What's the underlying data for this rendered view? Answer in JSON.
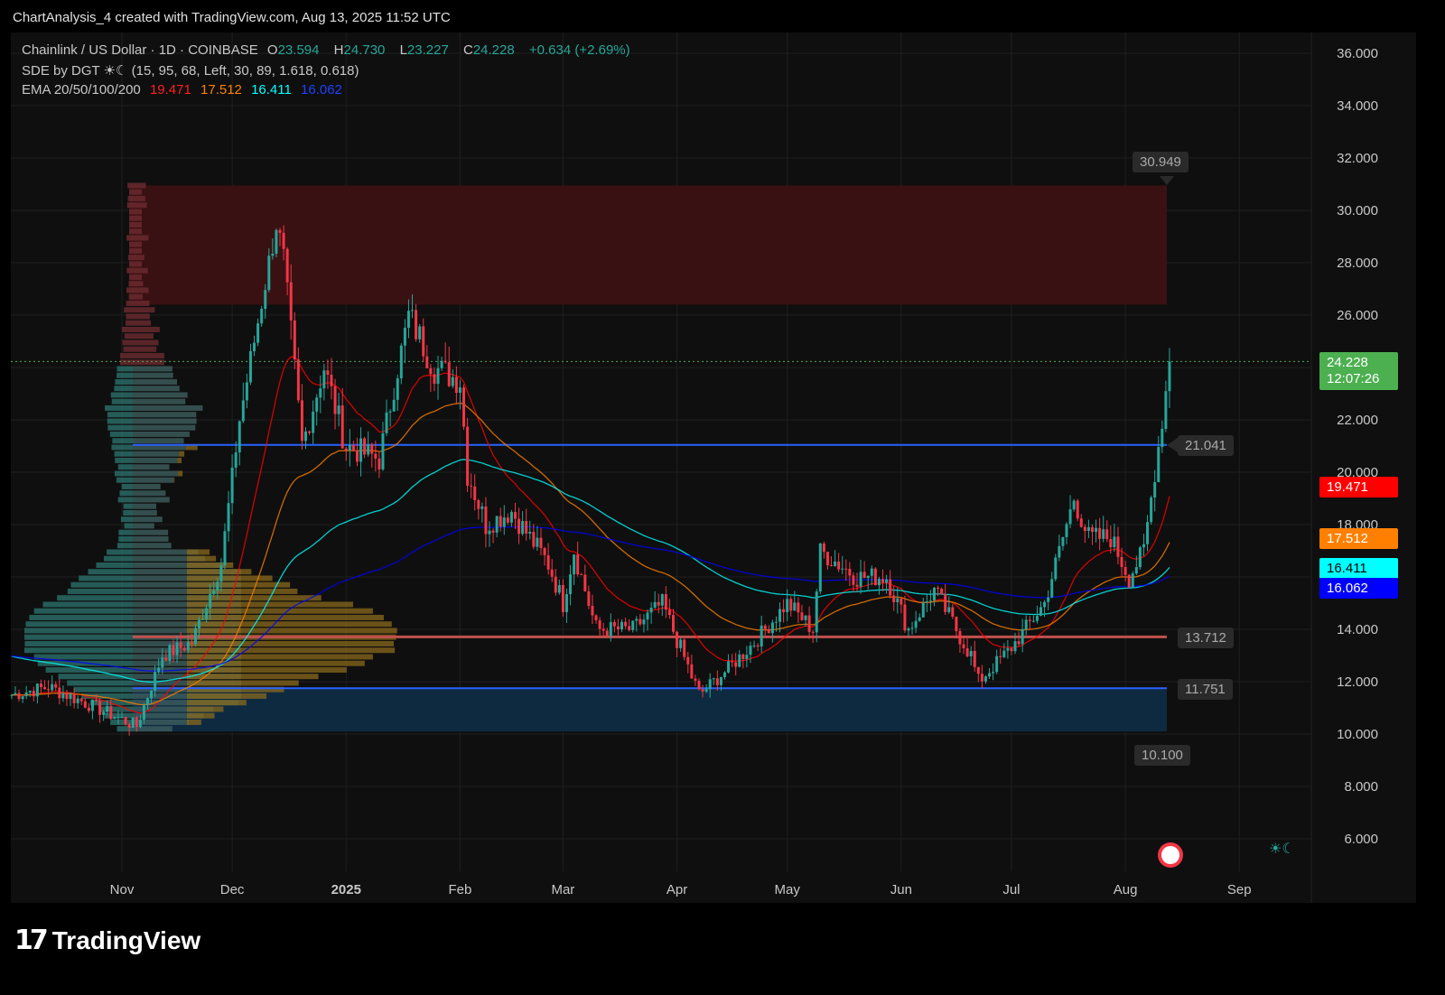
{
  "header": {
    "title": "ChartAnalysis_4 created with TradingView.com, Aug 13, 2025 11:52 UTC"
  },
  "legend": {
    "symbol": "Chainlink / US Dollar · 1D · COINBASE",
    "open_label": "O",
    "open": "23.594",
    "high_label": "H",
    "high": "24.730",
    "low_label": "L",
    "low": "23.227",
    "close_label": "C",
    "close": "24.228",
    "change": "+0.634 (+2.69%)",
    "sde": "SDE by DGT ☀☾ (15, 95, 68, Left, 30, 89, 1.618, 0.618)",
    "ema_label": "EMA 20/50/100/200",
    "ema": [
      "19.471",
      "17.512",
      "16.411",
      "16.062"
    ]
  },
  "colors": {
    "up": "#26a69a",
    "down": "#f23645",
    "ema20": "#ff0000",
    "ema50": "#ff8000",
    "ema100": "#00ffff",
    "ema200": "#0000ff",
    "last": "#4caf50"
  },
  "price_tags": {
    "last": "24.228",
    "countdown": "12:07:26",
    "ema20": "19.471",
    "ema50": "17.512",
    "ema100": "16.411",
    "ema200": "16.062"
  },
  "annotations": {
    "zone_top": "30.949",
    "level1": "21.041",
    "level2": "13.712",
    "level3": "11.751",
    "zone_bottom": "10.100"
  },
  "branding": {
    "logo": "TradingView"
  },
  "chart_data": {
    "type": "candlestick",
    "title": "Chainlink / US Dollar · 1D · COINBASE",
    "y_ticks": [
      "36.000",
      "34.000",
      "32.000",
      "30.000",
      "28.000",
      "26.000",
      "24.000",
      "22.000",
      "20.000",
      "18.000",
      "16.000",
      "14.000",
      "12.000",
      "10.000",
      "8.000",
      "6.000"
    ],
    "ylim": [
      5,
      37
    ],
    "x_ticks": [
      {
        "label": "Nov",
        "day": 0
      },
      {
        "label": "Dec",
        "day": 30
      },
      {
        "label": "2025",
        "day": 61
      },
      {
        "label": "Feb",
        "day": 92
      },
      {
        "label": "Mar",
        "day": 120
      },
      {
        "label": "Apr",
        "day": 151
      },
      {
        "label": "May",
        "day": 181
      },
      {
        "label": "Jun",
        "day": 212
      },
      {
        "label": "Jul",
        "day": 242
      },
      {
        "label": "Aug",
        "day": 273
      },
      {
        "label": "Sep",
        "day": 304
      }
    ],
    "close_path": [
      [
        -30,
        11.5
      ],
      [
        -20,
        11.8
      ],
      [
        -10,
        11.2
      ],
      [
        4,
        10.3
      ],
      [
        11,
        13
      ],
      [
        19,
        13.5
      ],
      [
        27,
        16.5
      ],
      [
        32,
        22
      ],
      [
        42,
        29.5
      ],
      [
        44,
        28
      ],
      [
        49,
        21
      ],
      [
        55,
        24
      ],
      [
        61,
        21
      ],
      [
        70,
        20.5
      ],
      [
        78,
        26
      ],
      [
        85,
        24
      ],
      [
        92,
        23.5
      ],
      [
        94,
        20
      ],
      [
        99,
        18
      ],
      [
        106,
        18.5
      ],
      [
        116,
        16.5
      ],
      [
        120,
        15
      ],
      [
        123,
        17
      ],
      [
        129,
        14
      ],
      [
        139,
        14
      ],
      [
        147,
        15
      ],
      [
        157,
        11.5
      ],
      [
        165,
        12.5
      ],
      [
        172,
        13.5
      ],
      [
        181,
        15
      ],
      [
        188,
        14
      ],
      [
        190,
        17
      ],
      [
        200,
        16
      ],
      [
        208,
        16
      ],
      [
        214,
        14
      ],
      [
        221,
        15.5
      ],
      [
        231,
        13
      ],
      [
        233,
        12
      ],
      [
        242,
        13.3
      ],
      [
        251,
        15
      ],
      [
        259,
        19
      ],
      [
        263,
        17.5
      ],
      [
        269,
        17.5
      ],
      [
        274,
        16
      ],
      [
        278,
        17
      ],
      [
        281,
        20
      ],
      [
        283,
        22
      ],
      [
        285,
        24.228
      ]
    ],
    "last_candle": {
      "open": 23.594,
      "high": 24.73,
      "low": 23.227,
      "close": 24.228
    },
    "ema": {
      "20": 19.471,
      "50": 17.512,
      "100": 16.411,
      "200": 16.062
    },
    "zones": [
      {
        "name": "supply",
        "from": 26.4,
        "to": 30.949
      },
      {
        "name": "demand",
        "from": 10.1,
        "to": 11.751
      }
    ],
    "levels": [
      21.041,
      13.712,
      11.751
    ]
  }
}
